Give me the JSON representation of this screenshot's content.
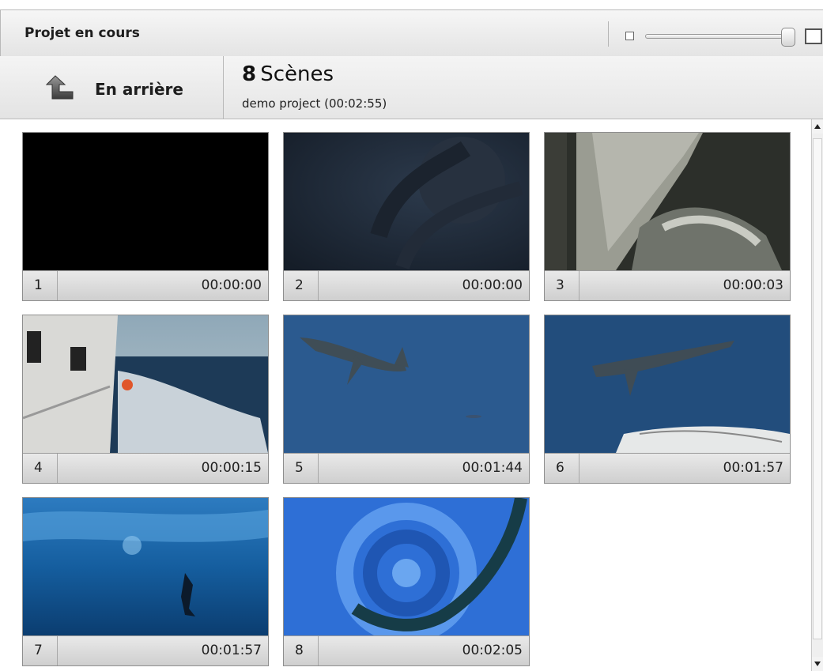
{
  "header": {
    "title": "Projet en cours",
    "zoom": {
      "level": 0.95,
      "small_icon": "thumbnail-small-icon",
      "large_icon": "thumbnail-large-icon"
    }
  },
  "nav": {
    "back_label": "En arrière",
    "back_icon": "back-arrow-icon",
    "scene_count": "8",
    "scenes_word": "Scènes",
    "project_info": "demo project (00:02:55)"
  },
  "scenes": [
    {
      "number": "1",
      "time": "00:00:00"
    },
    {
      "number": "2",
      "time": "00:00:00"
    },
    {
      "number": "3",
      "time": "00:00:03"
    },
    {
      "number": "4",
      "time": "00:00:15"
    },
    {
      "number": "5",
      "time": "00:01:44"
    },
    {
      "number": "6",
      "time": "00:01:57"
    },
    {
      "number": "7",
      "time": "00:01:57"
    },
    {
      "number": "8",
      "time": "00:02:05"
    }
  ]
}
